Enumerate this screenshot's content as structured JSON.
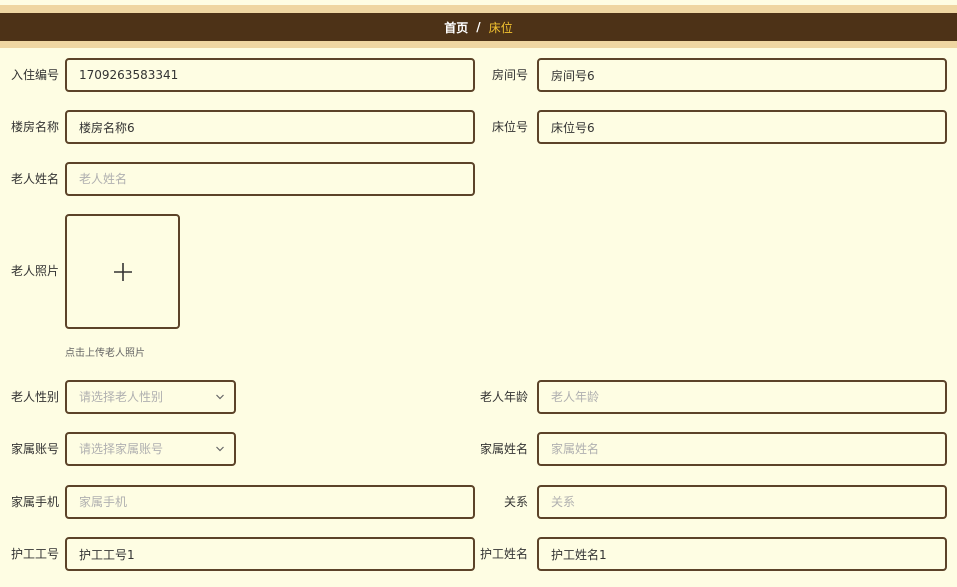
{
  "breadcrumb": {
    "home": "首页",
    "separator": "/",
    "current": "床位"
  },
  "form": {
    "checkin_no": {
      "label": "入住编号",
      "value": "1709263583341"
    },
    "room_no": {
      "label": "房间号",
      "value": "房间号6"
    },
    "building_name": {
      "label": "楼房名称",
      "value": "楼房名称6"
    },
    "bed_no": {
      "label": "床位号",
      "value": "床位号6"
    },
    "elder_name": {
      "label": "老人姓名",
      "value": "",
      "placeholder": "老人姓名"
    },
    "elder_photo": {
      "label": "老人照片",
      "hint": "点击上传老人照片"
    },
    "elder_gender": {
      "label": "老人性别",
      "placeholder": "请选择老人性别"
    },
    "elder_age": {
      "label": "老人年龄",
      "value": "",
      "placeholder": "老人年龄"
    },
    "family_account": {
      "label": "家属账号",
      "placeholder": "请选择家属账号"
    },
    "family_name": {
      "label": "家属姓名",
      "value": "",
      "placeholder": "家属姓名"
    },
    "family_phone": {
      "label": "家属手机",
      "value": "",
      "placeholder": "家属手机"
    },
    "relation": {
      "label": "关系",
      "value": "",
      "placeholder": "关系"
    },
    "nurse_no": {
      "label": "护工工号",
      "value": "护工工号1"
    },
    "nurse_name": {
      "label": "护工姓名",
      "value": "护工姓名1"
    }
  },
  "colors": {
    "background": "#fefde3",
    "header": "#4d3217",
    "header_border": "#efd6a2",
    "accent": "#f2c230",
    "field_border": "#5c4329"
  }
}
